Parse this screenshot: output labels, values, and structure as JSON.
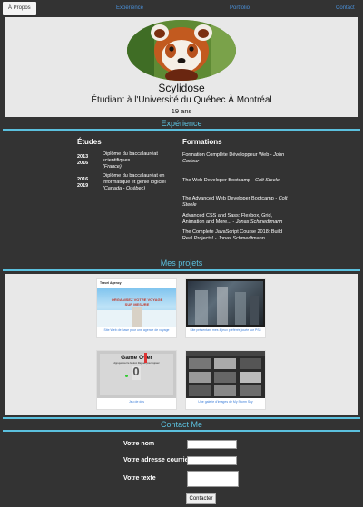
{
  "nav": {
    "items": [
      {
        "label": "À Propos"
      },
      {
        "label": "Expérience"
      },
      {
        "label": "Portfolio"
      },
      {
        "label": "Contact"
      }
    ]
  },
  "profile": {
    "avatar_icon": "red-panda-photo",
    "name": "Scylidose",
    "subtitle": "Étudiant à l'Université du Québec À Montréal",
    "age": "19 ans"
  },
  "experience": {
    "title": "Expérience",
    "studies_title": "Études",
    "studies": [
      {
        "year_start": "2013",
        "year_end": "2016",
        "text": "Diplôme du baccalauréat scientifiques",
        "place": "(France)"
      },
      {
        "year_start": "2016",
        "year_end": "2019",
        "text": "Diplôme du baccalauréat en informatique et génie logiciel",
        "place": "(Canada - Québec)"
      }
    ],
    "formations_title": "Formations",
    "formations": [
      {
        "text": "Formation Complète Développeur Web - ",
        "author": "John Codeur"
      },
      {
        "text": "The Web Developer Bootcamp - ",
        "author": "Colt Steele"
      },
      {
        "text": "The Advanced Web Developer Bootcamp - ",
        "author": "Colt Steele"
      },
      {
        "text": "Advanced CSS and Sass: Flexbox, Grid, Animation and More... - ",
        "author": "Jonas Schmedtmann"
      },
      {
        "text": "The Complete JavaScript Course 2018: Build Real Projects! - ",
        "author": "Jonas Schmedtmann"
      }
    ]
  },
  "projects": {
    "title": "Mes projets",
    "items": [
      {
        "caption": "Site Web de base pour une agence de voyage",
        "thumb_title": "Travel Agency",
        "thumb_text": "ORGANISEZ VOTRE VOYAGE SUR MESURE"
      },
      {
        "caption": "Site présentant mes 4 jeux préférés jouée sur PS4",
        "thumb_title": "",
        "thumb_text": ""
      },
      {
        "caption": "Jeu de dés",
        "thumb_title": "Game Over",
        "thumb_text": "Appuyez sur le bouton Rejouer pour rejouer",
        "thumb_score": "0"
      },
      {
        "caption": "Une galerie d'images de My Storm Sky",
        "thumb_title": "",
        "thumb_text": ""
      }
    ]
  },
  "contact": {
    "title": "Contact Me",
    "name_label": "Votre nom",
    "email_label": "Votre adresse courriel",
    "message_label": "Votre texte",
    "submit_label": "Contacter"
  },
  "colors": {
    "background": "#333333",
    "accent": "#5bc0de",
    "panel": "#e8e8e8",
    "link": "#4a90d9"
  }
}
